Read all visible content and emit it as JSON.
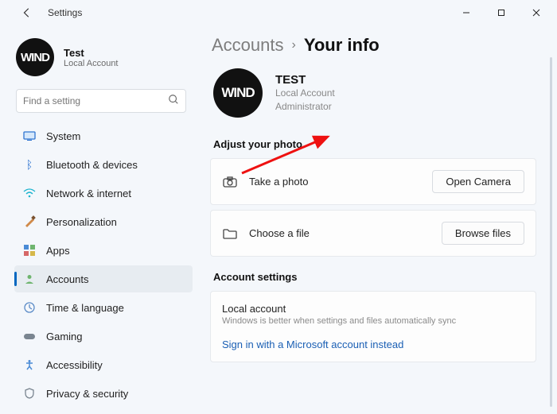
{
  "titlebar": {
    "title": "Settings"
  },
  "sidebar": {
    "user": {
      "avatar_text": "WIND",
      "name": "Test",
      "sub": "Local Account"
    },
    "search_placeholder": "Find a setting",
    "items": [
      {
        "label": "System"
      },
      {
        "label": "Bluetooth & devices"
      },
      {
        "label": "Network & internet"
      },
      {
        "label": "Personalization"
      },
      {
        "label": "Apps"
      },
      {
        "label": "Accounts"
      },
      {
        "label": "Time & language"
      },
      {
        "label": "Gaming"
      },
      {
        "label": "Accessibility"
      },
      {
        "label": "Privacy & security"
      }
    ]
  },
  "main": {
    "breadcrumb": {
      "parent": "Accounts",
      "current": "Your info"
    },
    "profile": {
      "avatar_text": "WIND",
      "name": "TEST",
      "line1": "Local Account",
      "line2": "Administrator"
    },
    "photo_section": {
      "heading": "Adjust your photo",
      "take_label": "Take a photo",
      "take_btn": "Open Camera",
      "choose_label": "Choose a file",
      "choose_btn": "Browse files"
    },
    "account_section": {
      "heading": "Account settings",
      "title": "Local account",
      "subtitle": "Windows is better when settings and files automatically sync",
      "link": "Sign in with a Microsoft account instead"
    }
  }
}
